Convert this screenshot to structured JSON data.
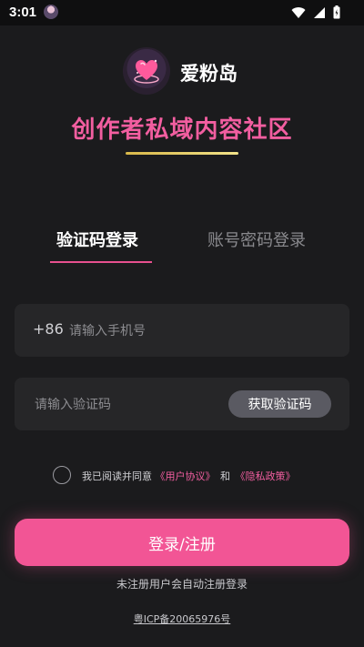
{
  "status_bar": {
    "time": "3:01"
  },
  "brand": {
    "name": "爱粉岛",
    "logo_icon": "heart-island-logo",
    "slogan": "创作者私域内容社区"
  },
  "tabs": [
    {
      "label": "验证码登录",
      "active": true
    },
    {
      "label": "账号密码登录",
      "active": false
    }
  ],
  "phone": {
    "country_code": "+86",
    "placeholder": "请输入手机号",
    "value": ""
  },
  "code": {
    "placeholder": "请输入验证码",
    "value": "",
    "get_code_label": "获取验证码"
  },
  "agreement": {
    "checked": false,
    "prefix": "我已阅读并同意",
    "user_agreement": "《用户协议》",
    "and": "和",
    "privacy_policy": "《隐私政策》"
  },
  "login_button": "登录/注册",
  "auto_register_note": "未注册用户会自动注册登录",
  "icp": "粤ICP备20065976号",
  "colors": {
    "accent": "#f25595",
    "background": "#1b1b1d",
    "input_bg": "#262628"
  }
}
